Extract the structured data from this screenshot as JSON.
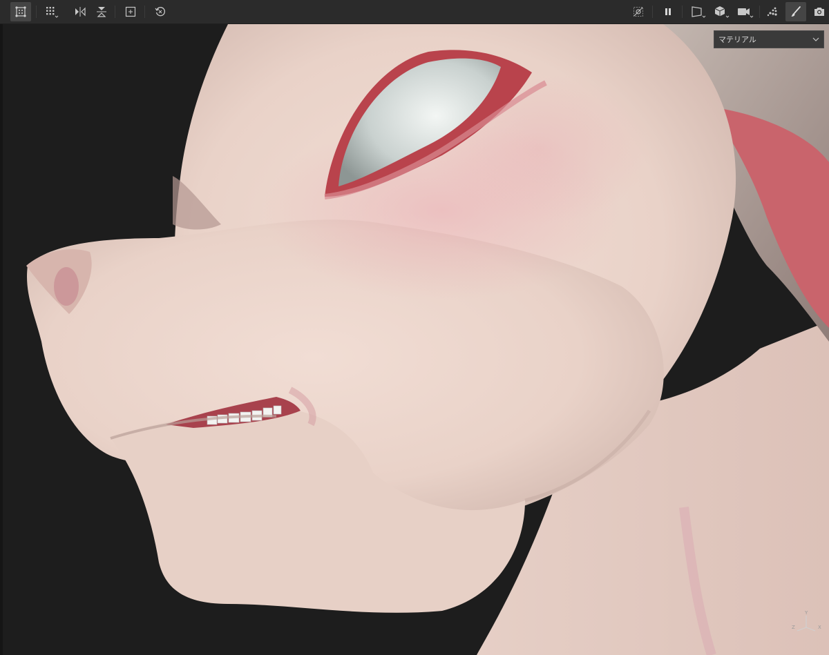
{
  "viewport": {
    "material_dropdown": {
      "selected": "マテリアル"
    },
    "axis_gizmo": {
      "y": "Y",
      "z": "Z",
      "x": "X"
    }
  },
  "toolbar": {
    "left_icons": [
      "select-grid-icon",
      "grid-options-icon",
      "mirror-horizontal-icon",
      "mirror-vertical-icon",
      "frame-icon",
      "reset-view-icon"
    ],
    "right_icons": [
      "visibility-off-icon",
      "pause-icon",
      "perspective-icon",
      "cube-icon",
      "camera-icon",
      "lighting-icon",
      "brush-icon",
      "screenshot-icon"
    ]
  },
  "colors": {
    "toolbar_bg": "#2b2b2b",
    "active_button": "#454545",
    "skin": "#ead3c8",
    "skin_pink": "#e2aab0",
    "eye": "#cfd6d4"
  }
}
